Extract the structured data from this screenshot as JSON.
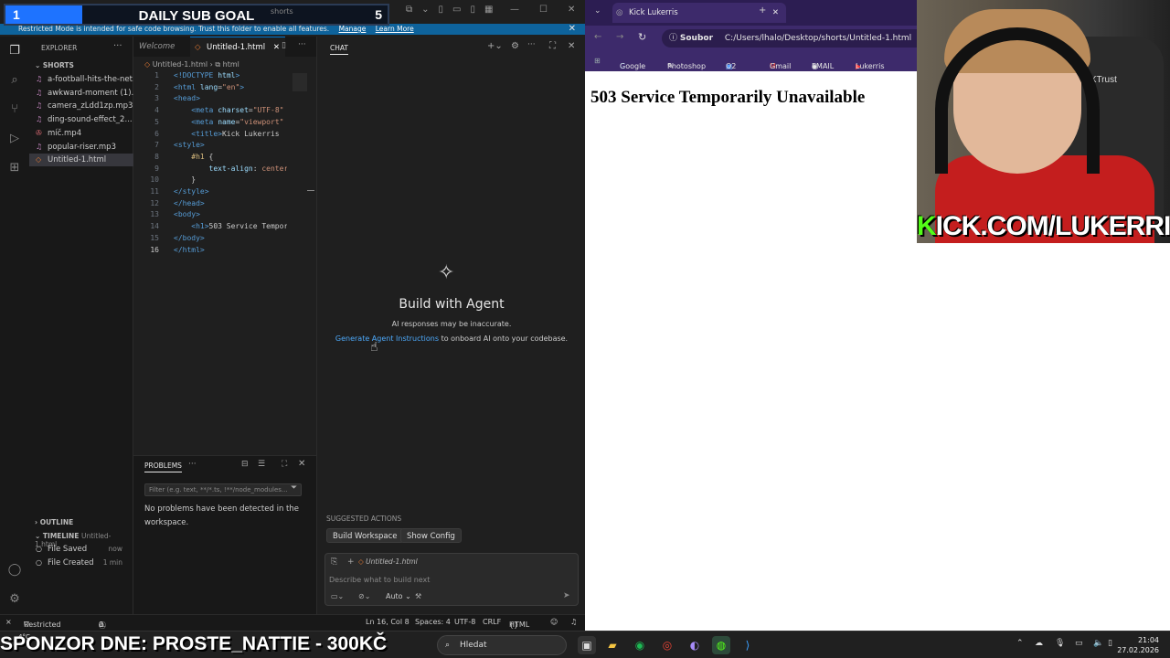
{
  "overlay": {
    "sub_current": "1",
    "title": "DAILY SUB GOAL",
    "sub_target": "5",
    "search_placeholder": "shorts",
    "progress": 0.2
  },
  "banner": {
    "text": "Restricted Mode is intended for safe code browsing. Trust this folder to enable all features.",
    "manage": "Manage",
    "learn_more": "Learn More"
  },
  "explorer": {
    "title": "EXPLORER",
    "folder": "SHORTS",
    "files": [
      {
        "name": "a-football-hits-the-net...",
        "kind": "audio"
      },
      {
        "name": "awkward-moment (1)...",
        "kind": "audio"
      },
      {
        "name": "camera_zLdd1zp.mp3",
        "kind": "audio"
      },
      {
        "name": "ding-sound-effect_2...",
        "kind": "audio"
      },
      {
        "name": "míč.mp4",
        "kind": "video"
      },
      {
        "name": "popular-riser.mp3",
        "kind": "audio"
      },
      {
        "name": "Untitled-1.html",
        "kind": "html"
      }
    ],
    "outline": "OUTLINE",
    "timeline": "TIMELINE",
    "timeline_file": "Untitled-1.html",
    "timeline_items": [
      {
        "label": "File Saved",
        "time": "now"
      },
      {
        "label": "File Created",
        "time": "1 min"
      }
    ]
  },
  "editor": {
    "tabs": [
      {
        "label": "Welcome"
      },
      {
        "label": "Untitled-1.html"
      }
    ],
    "breadcrumb_file": "Untitled-1.html",
    "breadcrumb_node": "html",
    "lines": [
      "1",
      "2",
      "3",
      "4",
      "5",
      "6",
      "7",
      "8",
      "9",
      "10",
      "11",
      "12",
      "13",
      "14",
      "15",
      "16"
    ]
  },
  "problems": {
    "title": "PROBLEMS",
    "filter_placeholder": "Filter (e.g. text, **/*.ts, !**/node_modules...",
    "message": "No problems have been detected in the workspace."
  },
  "chat": {
    "title": "CHAT",
    "heading": "Build with Agent",
    "disclaimer": "AI responses may be inaccurate.",
    "link": "Generate Agent Instructions",
    "link_rest": "to onboard AI onto your codebase.",
    "suggested": "SUGGESTED ACTIONS",
    "actions": [
      {
        "label": "Build Workspace"
      },
      {
        "label": "Show Config"
      }
    ],
    "context_file": "Untitled-1.html",
    "input_placeholder": "Describe what to build next",
    "mode": "Auto"
  },
  "status": {
    "restricted": "Restricted Mode",
    "errors": "0",
    "warnings": "0",
    "position": "Ln 16, Col 8",
    "spaces": "Spaces: 4",
    "encoding": "UTF-8",
    "eol": "CRLF",
    "language": "HTML"
  },
  "browser": {
    "tab_title": "Kick Lukerris",
    "url_label": "Soubor",
    "url": "C:/Users/lhalo/Desktop/shorts/Untitled-1.html",
    "bookmarks": [
      {
        "label": "Google"
      },
      {
        "label": "Photoshop"
      },
      {
        "label": "O2 TV"
      },
      {
        "label": "Gmail"
      },
      {
        "label": "EMAIL"
      },
      {
        "label": "Lukerris Extra"
      }
    ],
    "page_heading": "503 Service Temporarily Unavailable"
  },
  "webcam": {
    "brand": "GXTrust",
    "kick_prefix": "K",
    "kick_rest": "ICK.COM/LUKERRIS"
  },
  "taskbar": {
    "sponsor": "SPONZOR DNE: PROSTE_NATTIE - 300KČ",
    "search": "Hledat",
    "time": "21:04",
    "date": "27.02.2026",
    "weather": "4°C"
  }
}
